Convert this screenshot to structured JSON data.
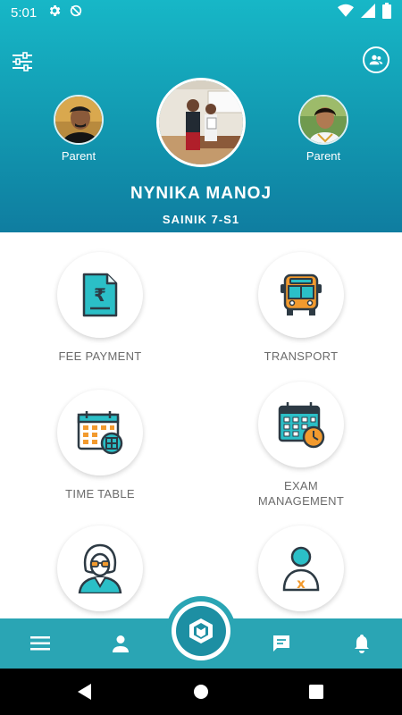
{
  "status_bar": {
    "time": "5:01",
    "icons": [
      "gear-icon",
      "sync-off-icon"
    ],
    "right_icons": [
      "wifi-icon",
      "signal-icon",
      "battery-icon"
    ]
  },
  "header": {
    "filter_icon": "sliders-icon",
    "contact_icon": "contacts-icon",
    "left_parent_label": "Parent",
    "right_parent_label": "Parent",
    "student_name": "NYNIKA MANOJ",
    "student_class": "SAINIK 7-S1"
  },
  "tiles": [
    {
      "label": "FEE PAYMENT",
      "icon": "rupee-document-icon"
    },
    {
      "label": "TRANSPORT",
      "icon": "bus-icon"
    },
    {
      "label": "TIME TABLE",
      "icon": "calendar-add-icon"
    },
    {
      "label": "EXAM",
      "label2": "MANAGEMENT",
      "icon": "calendar-clock-icon"
    },
    {
      "label": "",
      "icon": "teacher-icon"
    },
    {
      "label": "",
      "icon": "absent-user-icon"
    }
  ],
  "bottom_nav": {
    "items": [
      "menu-icon",
      "profile-icon",
      "home-logo-icon",
      "chat-icon",
      "bell-icon"
    ]
  },
  "colors": {
    "accent": "#2aa5b4",
    "header_top": "#17b7c7",
    "header_bottom": "#0f7da0",
    "icon_dark": "#2d3a44",
    "icon_teal": "#2bbfc7",
    "icon_orange": "#f29a2e"
  }
}
